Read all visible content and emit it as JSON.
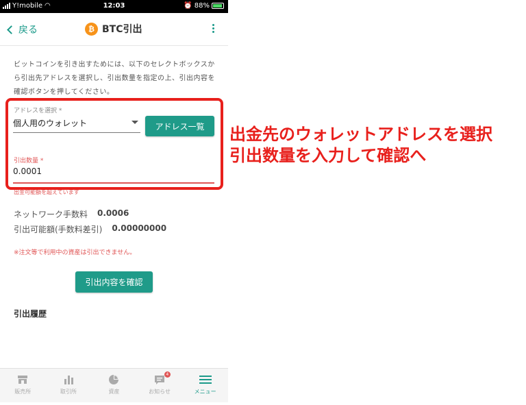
{
  "status": {
    "carrier": "Y!mobile",
    "time": "12:03",
    "battery": "88%"
  },
  "header": {
    "back_label": "戻る",
    "coin_symbol": "₿",
    "title": "BTC引出"
  },
  "description": "ビットコインを引き出すためには、以下のセレクトボックスから引出先アドレスを選択し、引出数量を指定の上、引出内容を確認ボタンを押してください。",
  "address": {
    "label": "アドレスを選択 *",
    "selected": "個人用のウォレット",
    "list_button": "アドレス一覧"
  },
  "amount": {
    "label": "引出数量 *",
    "value": "0.0001",
    "hint": "出金可能額を超えています"
  },
  "fees": {
    "network_fee_label": "ネットワーク手数料",
    "network_fee_value": "0.0006",
    "withdrawable_label": "引出可能額(手数料差引)",
    "withdrawable_value": "0.00000000"
  },
  "warning": "※注文等で利用中の資産は引出できません。",
  "confirm_button": "引出内容を確認",
  "history_title": "引出履歴",
  "tabs": [
    {
      "label": "販売所",
      "icon": "shop-icon"
    },
    {
      "label": "取引所",
      "icon": "bar-chart-icon"
    },
    {
      "label": "資産",
      "icon": "pie-chart-icon"
    },
    {
      "label": "お知らせ",
      "icon": "notification-icon",
      "badge": "4"
    },
    {
      "label": "メニュー",
      "icon": "menu-icon"
    }
  ],
  "annotation": {
    "line1": "出金先のウォレットアドレスを選択",
    "line2": "引出数量を入力して確認へ"
  },
  "colors": {
    "accent": "#1f9b89",
    "error": "#e05555",
    "annotation": "#e8201c"
  }
}
